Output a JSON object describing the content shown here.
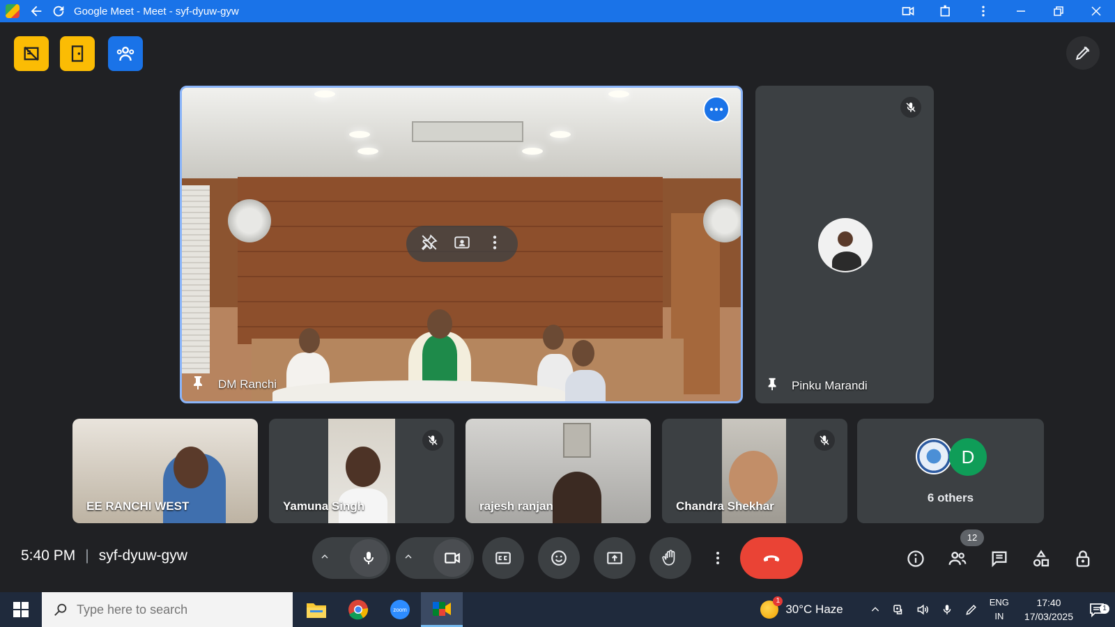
{
  "window": {
    "title": "Google Meet - Meet - syf-dyuw-gyw",
    "colors": {
      "titlebar": "#1a73e8",
      "background": "#202124"
    }
  },
  "main_tile": {
    "name": "DM Ranchi"
  },
  "side_tile": {
    "name": "Pinku Marandi"
  },
  "participants": [
    {
      "name": "EE RANCHI WEST"
    },
    {
      "name": "Yamuna Singh"
    },
    {
      "name": "rajesh ranjan"
    },
    {
      "name": "Chandra Shekhar"
    }
  ],
  "others": {
    "label": "6 others",
    "avatar_letter": "D"
  },
  "meeting": {
    "time": "5:40 PM",
    "code": "syf-dyuw-gyw"
  },
  "people_count": "12",
  "colors": {
    "end_call": "#ea4335",
    "accent_blue": "#1a73e8",
    "pin_yellow": "#fbbc04"
  },
  "taskbar": {
    "search_placeholder": "Type here to search",
    "weather": "30°C  Haze",
    "weather_badge": "1",
    "lang_top": "ENG",
    "lang_bottom": "IN",
    "time": "17:40",
    "date": "17/03/2025",
    "notification_count": "1"
  }
}
